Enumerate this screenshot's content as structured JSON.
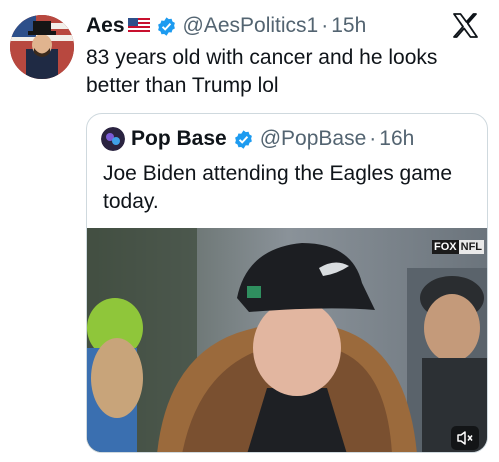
{
  "tweet": {
    "author": {
      "name": "Aes",
      "flag": "us-flag-emoji",
      "verified": true,
      "handle": "@AesPolitics1",
      "time": "15h",
      "separator": "·"
    },
    "text": "83 years old with cancer and he looks better than Trump lol",
    "platform_icon": "x-logo-icon"
  },
  "quote": {
    "author": {
      "name": "Pop Base",
      "verified": true,
      "handle": "@PopBase",
      "time": "16h",
      "separator": "·"
    },
    "text": "Joe Biden attending the Eagles game today.",
    "media": {
      "kind": "video",
      "broadcaster_badge": {
        "fox": "FOX",
        "nfl": "NFL"
      },
      "mute_icon": "volume-muted-icon"
    }
  },
  "colors": {
    "text": "#0f1419",
    "secondary": "#536471",
    "verified": "#1d9bf0",
    "border": "#cfd9de"
  }
}
